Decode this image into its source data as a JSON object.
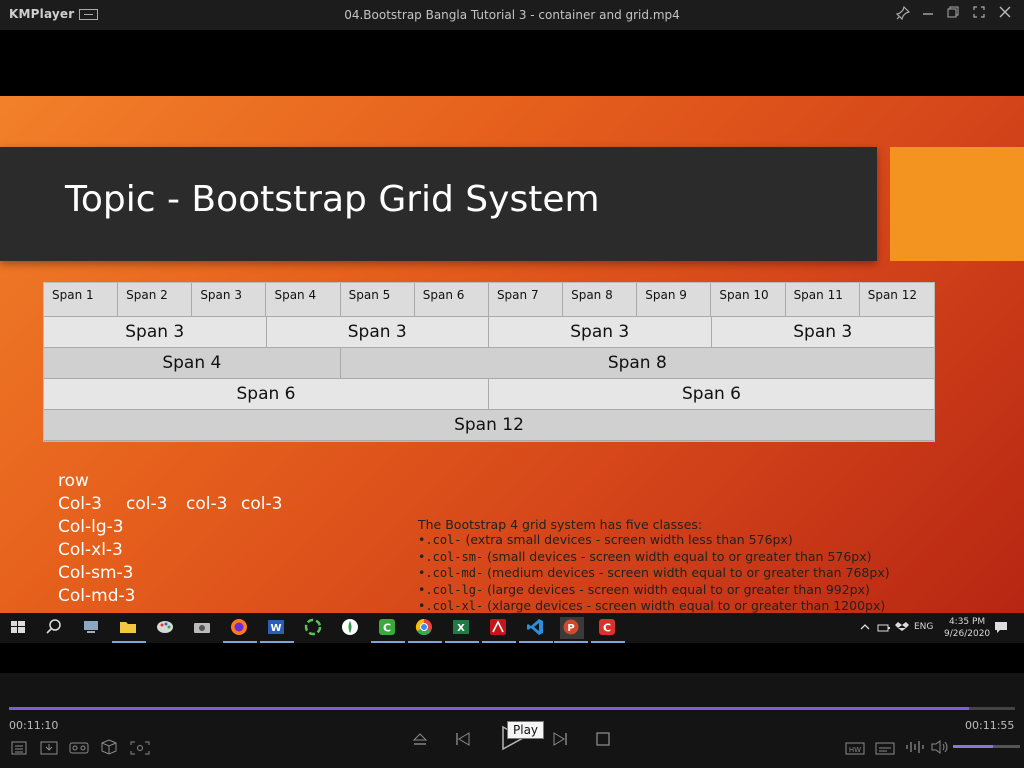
{
  "app": {
    "name": "KMPlayer",
    "title": "04.Bootstrap Bangla Tutorial 3 - container and grid.mp4"
  },
  "slide": {
    "topic": "Topic - Bootstrap Grid System",
    "grid": {
      "row12": [
        "Span 1",
        "Span 2",
        "Span 3",
        "Span 4",
        "Span 5",
        "Span 6",
        "Span 7",
        "Span 8",
        "Span 9",
        "Span 10",
        "Span 11",
        "Span 12"
      ],
      "row3": [
        "Span 3",
        "Span 3",
        "Span 3",
        "Span 3"
      ],
      "row48": [
        "Span 4",
        "Span 8"
      ],
      "row66": [
        "Span 6",
        "Span 6"
      ],
      "row12full": [
        "Span 12"
      ]
    },
    "left_lines": {
      "row": "row",
      "col_line": [
        "Col-3",
        "col-3",
        "col-3",
        "col-3"
      ],
      "lg": "Col-lg-3",
      "xl": "Col-xl-3",
      "sm": "Col-sm-3",
      "md": "Col-md-3"
    },
    "right_text": {
      "heading": "The Bootstrap 4 grid system has five classes:",
      "items": [
        {
          "code": ".col-",
          "desc": " (extra small devices - screen width less than 576px)"
        },
        {
          "code": ".col-sm-",
          "desc": " (small devices - screen width equal to or greater than 576px)"
        },
        {
          "code": ".col-md-",
          "desc": " (medium devices - screen width equal to or greater than 768px)"
        },
        {
          "code": ".col-lg-",
          "desc": " (large devices - screen width equal to or greater than 992px)"
        },
        {
          "code": ".col-xl-",
          "desc": " (xlarge devices - screen width equal to or greater than 1200px)"
        }
      ],
      "bullet": "•"
    }
  },
  "taskbar": {
    "language": "ENG",
    "time": "4:35 PM",
    "date": "9/26/2020"
  },
  "player": {
    "elapsed": "00:11:10",
    "duration": "00:11:55",
    "progress_fraction": 0.954,
    "volume_fraction": 0.6,
    "tooltip": "Play"
  },
  "colors": {
    "accent": "#f39420",
    "title_band": "#2b2b2b",
    "seek_fill": "#7c5fd6"
  }
}
